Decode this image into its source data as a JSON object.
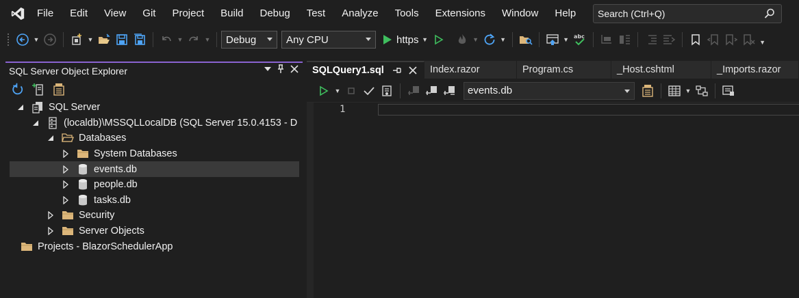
{
  "menu": {
    "items": [
      "File",
      "Edit",
      "View",
      "Git",
      "Project",
      "Build",
      "Debug",
      "Test",
      "Analyze",
      "Tools",
      "Extensions",
      "Window",
      "Help"
    ],
    "search_placeholder": "Search (Ctrl+Q)"
  },
  "toolbar": {
    "configuration": "Debug",
    "platform": "Any CPU",
    "run_target": "https"
  },
  "explorer": {
    "title": "SQL Server Object Explorer",
    "tree": [
      {
        "label": "SQL Server",
        "level": 0,
        "expander": "expanded",
        "icon": "sql-server-icon"
      },
      {
        "label": "(localdb)\\MSSQLLocalDB (SQL Server 15.0.4153 - D",
        "level": 1,
        "expander": "expanded",
        "icon": "server-instance-icon"
      },
      {
        "label": "Databases",
        "level": 2,
        "expander": "expanded",
        "icon": "folder-open-icon"
      },
      {
        "label": "System Databases",
        "level": 3,
        "expander": "collapsed",
        "icon": "folder-icon"
      },
      {
        "label": "events.db",
        "level": 3,
        "expander": "collapsed",
        "icon": "database-icon",
        "selected": true
      },
      {
        "label": "people.db",
        "level": 3,
        "expander": "collapsed",
        "icon": "database-icon"
      },
      {
        "label": "tasks.db",
        "level": 3,
        "expander": "collapsed",
        "icon": "database-icon"
      },
      {
        "label": "Security",
        "level": 2,
        "expander": "collapsed",
        "icon": "folder-icon"
      },
      {
        "label": "Server Objects",
        "level": 2,
        "expander": "collapsed",
        "icon": "folder-icon"
      },
      {
        "label": "Projects - BlazorSchedulerApp",
        "level": 0,
        "expander": "none",
        "icon": "folder-icon"
      }
    ]
  },
  "editor": {
    "tabs": [
      {
        "label": "SQLQuery1.sql",
        "active": true
      },
      {
        "label": "Index.razor",
        "active": false
      },
      {
        "label": "Program.cs",
        "active": false
      },
      {
        "label": "_Host.cshtml",
        "active": false
      },
      {
        "label": "_Imports.razor",
        "active": false
      }
    ],
    "database": "events.db",
    "line_number": "1"
  },
  "colors": {
    "accent": "#8a63d2",
    "folder": "#dcb67a",
    "run_green": "#3fbe5e",
    "icon_blue": "#4ea4f6"
  }
}
